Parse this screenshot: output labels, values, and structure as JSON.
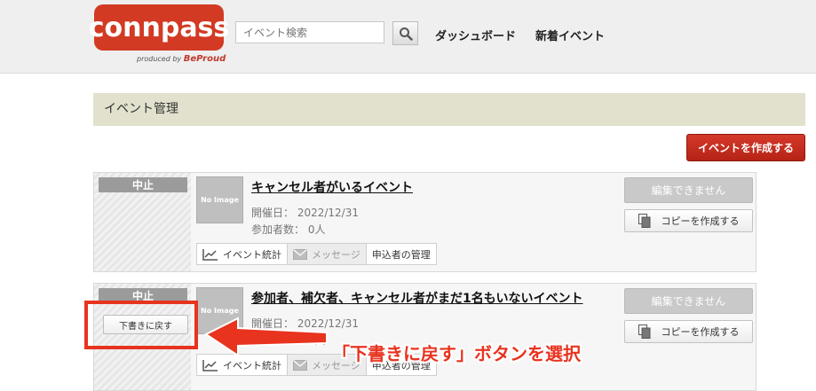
{
  "header": {
    "logo_text": "connpass",
    "logo_sub": "produced by",
    "logo_sub_brand": "BeProud",
    "search_placeholder": "イベント検索",
    "nav": [
      "ダッシュボード",
      "新着イベント"
    ]
  },
  "section_title": "イベント管理",
  "create_button": "イベントを作成する",
  "events": [
    {
      "status": "中止",
      "thumbnail": "No Image",
      "title": "キャンセル者がいるイベント",
      "date_line": "開催日： 2022/12/31",
      "count_line": "参加者数： 0人",
      "actions": [
        "イベント統計",
        "メッセージ",
        "申込者の管理"
      ],
      "edit_button": "編集できません",
      "copy_button": "コピーを作成する"
    },
    {
      "status": "中止",
      "thumbnail": "No Image",
      "title": "参加者、補欠者、キャンセル者がまだ1名もいないイベント",
      "date_line": "開催日： 2022/12/31",
      "count_line": "参加者数： 0人",
      "revert_button": "下書きに戻す",
      "actions": [
        "イベント統計",
        "メッセージ",
        "申込者の管理"
      ],
      "edit_button": "編集できません",
      "copy_button": "コピーを作成する"
    }
  ],
  "annotation": "「下書きに戻す」ボタンを選択",
  "colors": {
    "brand": "#d23a23",
    "annotation": "#e8331f",
    "section_bar": "#e1e1cd"
  }
}
